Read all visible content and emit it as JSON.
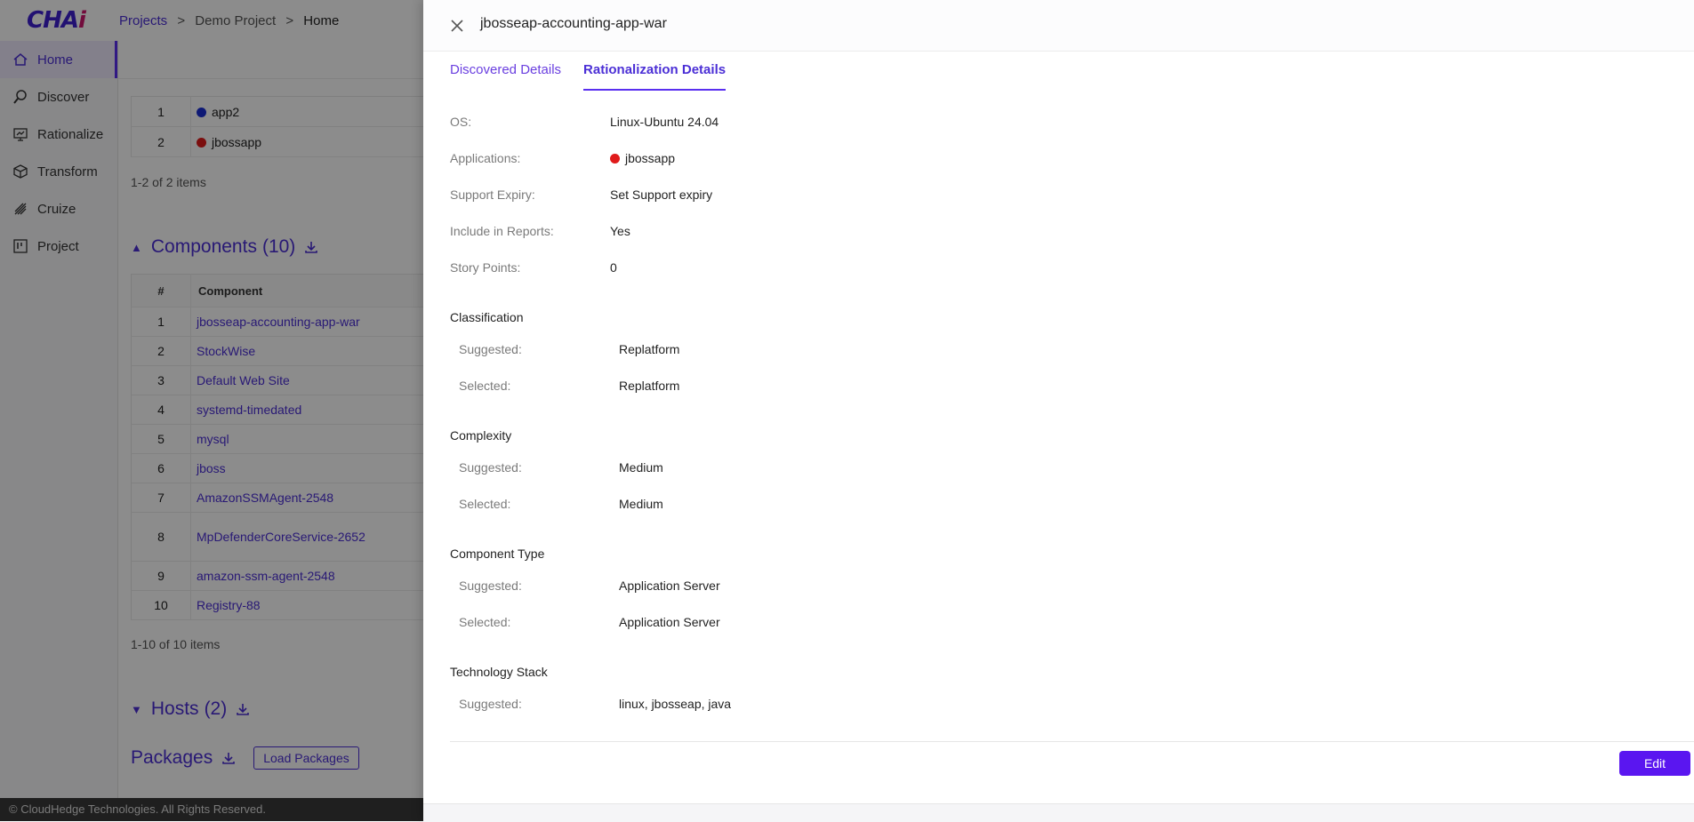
{
  "logo": {
    "text_main": "CHA",
    "text_accent": "i"
  },
  "breadcrumb": {
    "projects": "Projects",
    "sep": ">",
    "project": "Demo Project",
    "current": "Home"
  },
  "sidebar": {
    "items": [
      {
        "label": "Home",
        "icon": "home-icon"
      },
      {
        "label": "Discover",
        "icon": "discover-icon"
      },
      {
        "label": "Rationalize",
        "icon": "rationalize-icon"
      },
      {
        "label": "Transform",
        "icon": "transform-icon"
      },
      {
        "label": "Cruize",
        "icon": "cruize-icon"
      },
      {
        "label": "Project",
        "icon": "project-icon"
      }
    ]
  },
  "applications_table": {
    "rows": [
      {
        "num": "1",
        "name": "app2",
        "color": "#1a2fd6"
      },
      {
        "num": "2",
        "name": "jbossapp",
        "color": "#e01b1b"
      }
    ],
    "pager": "1-2 of 2 items"
  },
  "components": {
    "title": "Components",
    "count": "(10)",
    "headers": {
      "num": "#",
      "component": "Component"
    },
    "rows": [
      {
        "num": "1",
        "name": "jbosseap-accounting-app-war"
      },
      {
        "num": "2",
        "name": "StockWise"
      },
      {
        "num": "3",
        "name": "Default Web Site"
      },
      {
        "num": "4",
        "name": "systemd-timedated"
      },
      {
        "num": "5",
        "name": "mysql"
      },
      {
        "num": "6",
        "name": "jboss"
      },
      {
        "num": "7",
        "name": "AmazonSSMAgent-2548"
      },
      {
        "num": "8",
        "name": "MpDefenderCoreService-2652"
      },
      {
        "num": "9",
        "name": "amazon-ssm-agent-2548"
      },
      {
        "num": "10",
        "name": "Registry-88"
      }
    ],
    "pager": "1-10 of 10 items"
  },
  "hosts": {
    "title": "Hosts",
    "count": "(2)"
  },
  "packages": {
    "title": "Packages",
    "load_label": "Load Packages"
  },
  "footer": {
    "text": "© CloudHedge Technologies. All Rights Reserved."
  },
  "drawer": {
    "title": "jbosseap-accounting-app-war",
    "tabs": [
      {
        "label": "Discovered Details",
        "active": false
      },
      {
        "label": "Rationalization Details",
        "active": true
      }
    ],
    "details": {
      "os_label": "OS:",
      "os_value": "Linux-Ubuntu 24.04",
      "apps_label": "Applications:",
      "apps_value": "jbossapp",
      "apps_color": "#e01b1b",
      "support_label": "Support Expiry:",
      "support_value": "Set Support expiry",
      "reports_label": "Include in Reports:",
      "reports_value": "Yes",
      "story_label": "Story Points:",
      "story_value": "0"
    },
    "classification": {
      "title": "Classification",
      "suggested_label": "Suggested:",
      "suggested": "Replatform",
      "selected_label": "Selected:",
      "selected": "Replatform"
    },
    "complexity": {
      "title": "Complexity",
      "suggested_label": "Suggested:",
      "suggested": "Medium",
      "selected_label": "Selected:",
      "selected": "Medium"
    },
    "component_type": {
      "title": "Component Type",
      "suggested_label": "Suggested:",
      "suggested": "Application Server",
      "selected_label": "Selected:",
      "selected": "Application Server"
    },
    "tech_stack": {
      "title": "Technology Stack",
      "suggested_label": "Suggested:",
      "suggested": "linux, jbosseap, java"
    },
    "edit_label": "Edit"
  },
  "colors": {
    "accent": "#5a16f0",
    "link": "#4b2fd6",
    "overlay": "rgba(0,0,0,0.45)"
  }
}
